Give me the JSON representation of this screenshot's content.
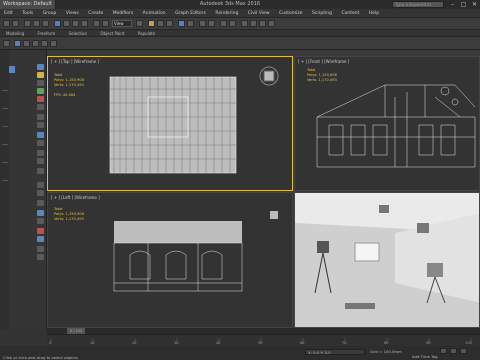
{
  "window": {
    "workspace": "Workspace: Default",
    "title": "Autodesk 3ds Max 2016    PhotoStudio_Scene2max.max",
    "search_placeholder": "Type a keyword or phrase",
    "minimize": "–",
    "maximize": "□",
    "close": "✕"
  },
  "menu": [
    "Edit",
    "Tools",
    "Group",
    "Views",
    "Create",
    "Modifiers",
    "Animation",
    "Graph Editors",
    "Rendering",
    "Civil View",
    "Customize",
    "Scripting",
    "Content",
    "Help"
  ],
  "toolbar": {
    "selection_filter": "All",
    "view_dropdown": "View"
  },
  "ribbon": [
    "Modeling",
    "Freeform",
    "Selection",
    "Object Paint",
    "Populate"
  ],
  "viewports": {
    "top": {
      "label": "[ + ] [Top ] [Wireframe ]",
      "stats_title": "Total",
      "polys": "Polys:   1,150,908",
      "verts": "Verts:   1,170,493",
      "fps": "FPS:     44.084"
    },
    "front": {
      "label": "[ + ] [Front ] [Wireframe ]",
      "stats_title": "Total",
      "polys": "Polys:   1,150,908",
      "verts": "Verts:   1,170,493"
    },
    "left": {
      "label": "[ + ] [Left ] [Wireframe ]",
      "stats_title": "Total",
      "polys": "Polys:   1,150,908",
      "verts": "Verts:   1,170,493"
    },
    "perspective": {
      "label": "[ + ] [Perspective ] [Realistic ]"
    }
  },
  "timeline": {
    "frame": "0 / 100",
    "ticks": [
      "0",
      "10",
      "20",
      "30",
      "40",
      "50",
      "60",
      "70",
      "80",
      "90",
      "100"
    ]
  },
  "status": {
    "message": "Click or click-and-drag to select objects",
    "coords": "X: 0.0   Y: 0.0",
    "grid": "Grid = 100.0mm",
    "time_tag": "Add Time Tag"
  },
  "colors": {
    "active_viewport_border": "#e0c040",
    "stats_text": "#e3c24a",
    "accent_blue": "#4f84c4"
  }
}
